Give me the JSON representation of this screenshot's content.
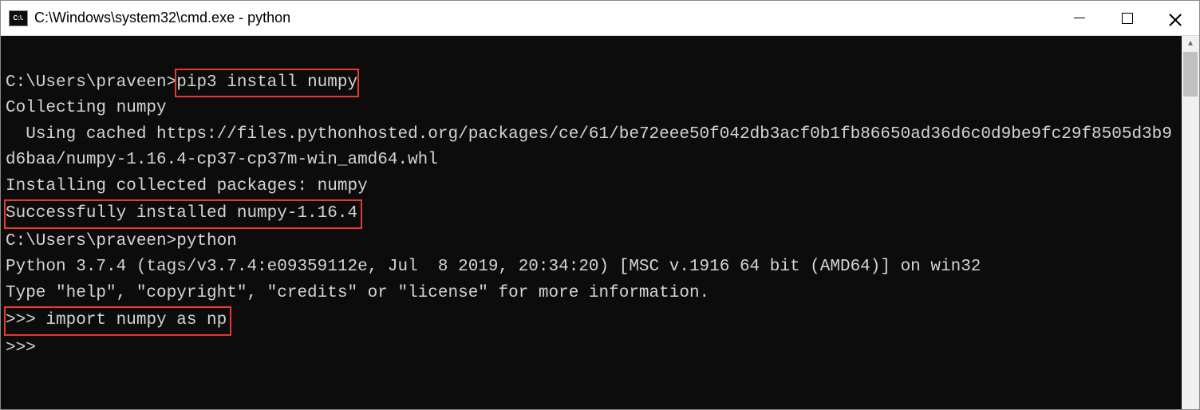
{
  "window": {
    "title": "C:\\Windows\\system32\\cmd.exe - python",
    "icon_label": "C:\\."
  },
  "terminal": {
    "blank_top": "",
    "line1_prompt": "C:\\Users\\praveen>",
    "line1_cmd": "pip3 install numpy",
    "line2": "Collecting numpy",
    "line3": "  Using cached https://files.pythonhosted.org/packages/ce/61/be72eee50f042db3acf0b1fb86650ad36d6c0d9be9fc29f8505d3b9d6baa/numpy-1.16.4-cp37-cp37m-win_amd64.whl",
    "line4": "Installing collected packages: numpy",
    "line5": "Successfully installed numpy-1.16.4",
    "blank_mid": "",
    "line6_prompt": "C:\\Users\\praveen>",
    "line6_cmd": "python",
    "line7": "Python 3.7.4 (tags/v3.7.4:e09359112e, Jul  8 2019, 20:34:20) [MSC v.1916 64 bit (AMD64)] on win32",
    "blank_mid2": "",
    "line8": "Type \"help\", \"copyright\", \"credits\" or \"license\" for more information.",
    "line9_prompt": ">>> ",
    "line9_cmd": "import numpy as np",
    "line10": ">>>"
  }
}
